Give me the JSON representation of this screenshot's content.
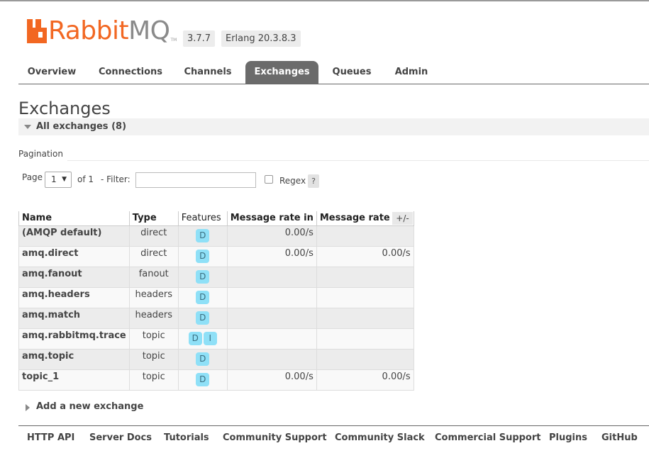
{
  "app": {
    "logo_rabbit": "Rabbit",
    "logo_mq": "MQ",
    "logo_tm": "TM",
    "version": "3.7.7",
    "erlang": "Erlang 20.3.8.3"
  },
  "tabs": [
    {
      "label": "Overview"
    },
    {
      "label": "Connections"
    },
    {
      "label": "Channels"
    },
    {
      "label": "Exchanges",
      "active": true
    },
    {
      "label": "Queues"
    },
    {
      "label": "Admin"
    }
  ],
  "page_title": "Exchanges",
  "section_title": "All exchanges (8)",
  "pagination": {
    "label": "Pagination",
    "page_label": "Page",
    "page_value": "1",
    "of_label": "of 1",
    "filter_label": "- Filter:",
    "filter_value": "",
    "regex_label": "Regex",
    "regex_checked": false,
    "help": "?"
  },
  "table": {
    "headers": [
      "Name",
      "Type",
      "Features",
      "Message rate in",
      "Message rate out"
    ],
    "toggle_columns": "+/-",
    "rows": [
      {
        "name": "(AMQP default)",
        "type": "direct",
        "features": [
          "D"
        ],
        "rate_in": "0.00/s",
        "rate_out": ""
      },
      {
        "name": "amq.direct",
        "type": "direct",
        "features": [
          "D"
        ],
        "rate_in": "0.00/s",
        "rate_out": "0.00/s"
      },
      {
        "name": "amq.fanout",
        "type": "fanout",
        "features": [
          "D"
        ],
        "rate_in": "",
        "rate_out": ""
      },
      {
        "name": "amq.headers",
        "type": "headers",
        "features": [
          "D"
        ],
        "rate_in": "",
        "rate_out": ""
      },
      {
        "name": "amq.match",
        "type": "headers",
        "features": [
          "D"
        ],
        "rate_in": "",
        "rate_out": ""
      },
      {
        "name": "amq.rabbitmq.trace",
        "type": "topic",
        "features": [
          "D",
          "I"
        ],
        "rate_in": "",
        "rate_out": ""
      },
      {
        "name": "amq.topic",
        "type": "topic",
        "features": [
          "D"
        ],
        "rate_in": "",
        "rate_out": ""
      },
      {
        "name": "topic_1",
        "type": "topic",
        "features": [
          "D"
        ],
        "rate_in": "0.00/s",
        "rate_out": "0.00/s"
      }
    ]
  },
  "add_exchange": "Add a new exchange",
  "footer": [
    "HTTP API",
    "Server Docs",
    "Tutorials",
    "Community Support",
    "Community Slack",
    "Commercial Support",
    "Plugins",
    "GitHub"
  ],
  "colors": {
    "brand": "#f26722",
    "active_tab": "#6b6b6b",
    "feature_badge": "#8fe0f7"
  }
}
